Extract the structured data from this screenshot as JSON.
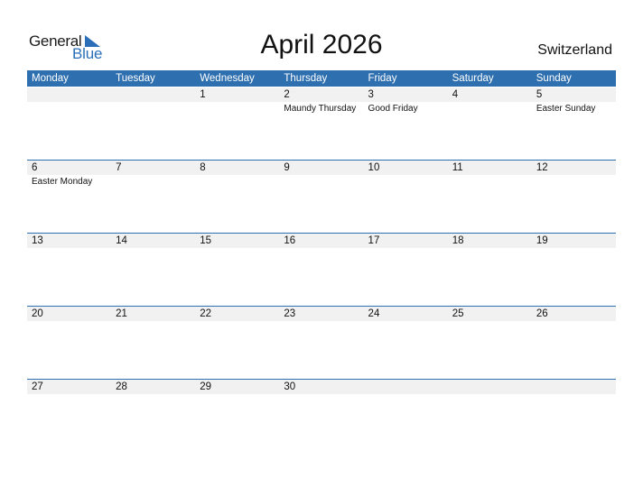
{
  "logo": {
    "general": "General",
    "blue": "Blue",
    "icon": "triangle-flag-icon",
    "accent": "#2a6fb8"
  },
  "title": "April 2026",
  "country": "Switzerland",
  "colors": {
    "header_bg": "#2e6fb0",
    "strip_bg": "#f1f1f1"
  },
  "weekdays": [
    "Monday",
    "Tuesday",
    "Wednesday",
    "Thursday",
    "Friday",
    "Saturday",
    "Sunday"
  ],
  "weeks": [
    [
      {
        "n": "",
        "h": ""
      },
      {
        "n": "",
        "h": ""
      },
      {
        "n": "1",
        "h": ""
      },
      {
        "n": "2",
        "h": "Maundy Thursday"
      },
      {
        "n": "3",
        "h": "Good Friday"
      },
      {
        "n": "4",
        "h": ""
      },
      {
        "n": "5",
        "h": "Easter Sunday"
      }
    ],
    [
      {
        "n": "6",
        "h": "Easter Monday"
      },
      {
        "n": "7",
        "h": ""
      },
      {
        "n": "8",
        "h": ""
      },
      {
        "n": "9",
        "h": ""
      },
      {
        "n": "10",
        "h": ""
      },
      {
        "n": "11",
        "h": ""
      },
      {
        "n": "12",
        "h": ""
      }
    ],
    [
      {
        "n": "13",
        "h": ""
      },
      {
        "n": "14",
        "h": ""
      },
      {
        "n": "15",
        "h": ""
      },
      {
        "n": "16",
        "h": ""
      },
      {
        "n": "17",
        "h": ""
      },
      {
        "n": "18",
        "h": ""
      },
      {
        "n": "19",
        "h": ""
      }
    ],
    [
      {
        "n": "20",
        "h": ""
      },
      {
        "n": "21",
        "h": ""
      },
      {
        "n": "22",
        "h": ""
      },
      {
        "n": "23",
        "h": ""
      },
      {
        "n": "24",
        "h": ""
      },
      {
        "n": "25",
        "h": ""
      },
      {
        "n": "26",
        "h": ""
      }
    ],
    [
      {
        "n": "27",
        "h": ""
      },
      {
        "n": "28",
        "h": ""
      },
      {
        "n": "29",
        "h": ""
      },
      {
        "n": "30",
        "h": ""
      },
      {
        "n": "",
        "h": ""
      },
      {
        "n": "",
        "h": ""
      },
      {
        "n": "",
        "h": ""
      }
    ]
  ]
}
